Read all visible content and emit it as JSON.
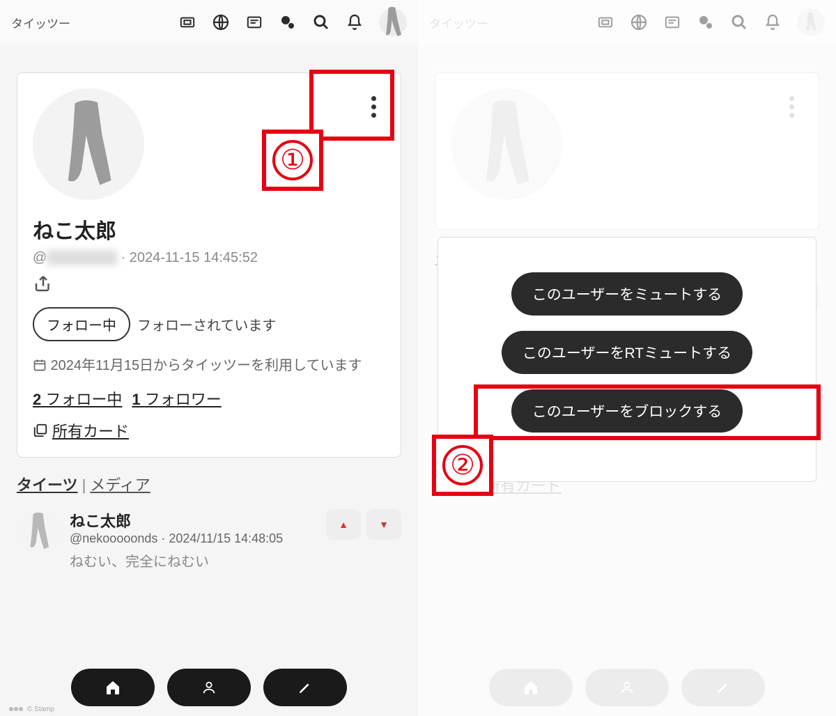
{
  "service_name": "タイッツー",
  "profile": {
    "display_name": "ねこ太郎",
    "handle_prefix": "@",
    "handle_blurred": "■■■■■■■■",
    "joined_timestamp": "2024-11-15 14:45:52",
    "follow_status": "フォロー中",
    "followed_by": "フォローされています",
    "joined_line": "2024年11月15日からタイッツーを利用しています",
    "following_count": "2",
    "following_label": "フォロー中",
    "follower_count": "1",
    "follower_label": "フォロワー",
    "cards_label": "所有カード"
  },
  "tabs": {
    "active": "タイーツ",
    "other": "メディア"
  },
  "post": {
    "name": "ねこ太郎",
    "handle": "@nekooooonds",
    "time_sep": " · ",
    "timestamp": "2024/11/15 14:48:05",
    "body": "ねむい、完全にねむい"
  },
  "menu": {
    "mute": "このユーザーをミュートする",
    "rt_mute": "このユーザーをRTミュートする",
    "block": "このユーザーをブロックする"
  },
  "annotations": {
    "step1": "①",
    "step2": "②"
  },
  "footer_stamp": "© Stamp"
}
